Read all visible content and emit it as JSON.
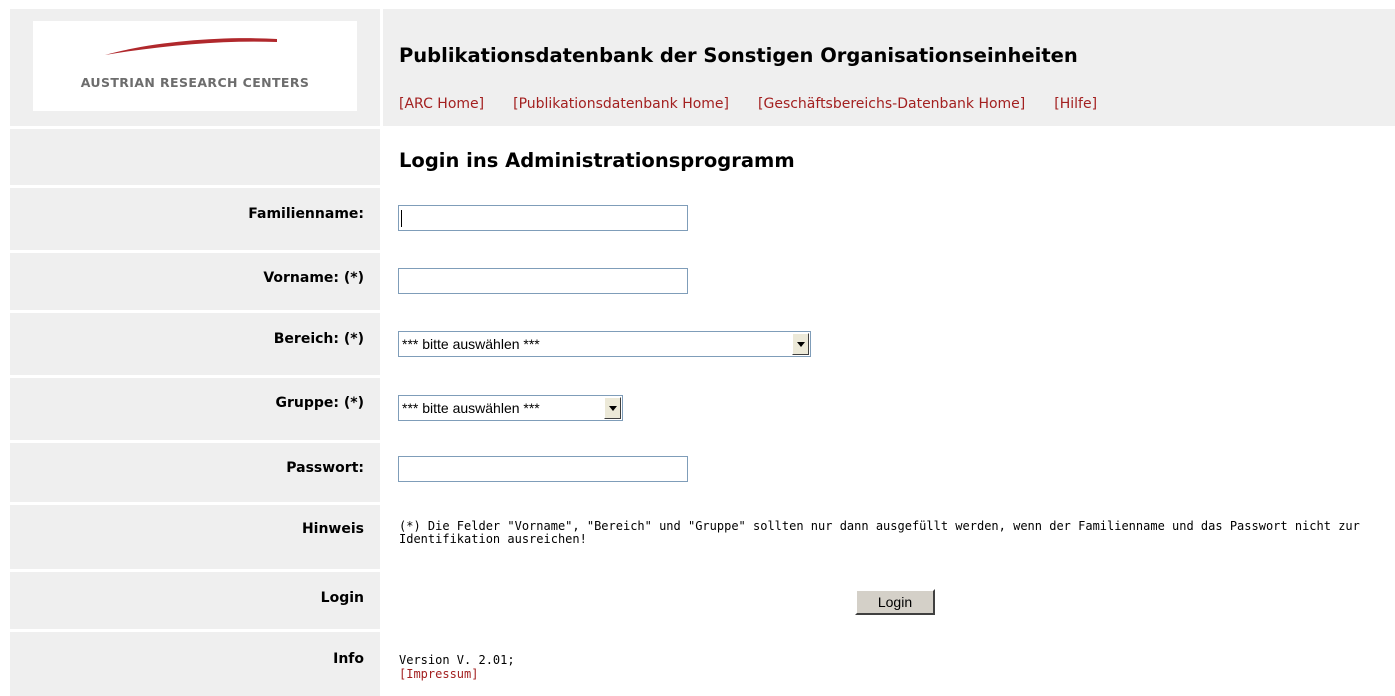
{
  "header": {
    "logo_text": "AUSTRIAN RESEARCH CENTERS",
    "title": "Publikationsdatenbank der Sonstigen Organisationseinheiten",
    "nav": [
      {
        "label": "[ARC Home]"
      },
      {
        "label": "[Publikationsdatenbank Home]"
      },
      {
        "label": "[Geschäftsbereichs-Datenbank Home]"
      },
      {
        "label": "[Hilfe]"
      }
    ]
  },
  "form": {
    "title": "Login ins Administrationsprogramm",
    "familienname": {
      "label": "Familienname:",
      "value": ""
    },
    "vorname": {
      "label": "Vorname: (*)",
      "value": ""
    },
    "bereich": {
      "label": "Bereich: (*)",
      "selected": "*** bitte auswählen ***"
    },
    "gruppe": {
      "label": "Gruppe: (*)",
      "selected": "*** bitte auswählen ***"
    },
    "passwort": {
      "label": "Passwort:",
      "value": ""
    },
    "hinweis": {
      "label": "Hinweis",
      "text": "(*) Die Felder \"Vorname\", \"Bereich\" und \"Gruppe\" sollten nur dann ausgefüllt werden, wenn der Familienname und das Passwort nicht zur Identifikation ausreichen!"
    },
    "login": {
      "label": "Login",
      "button": "Login"
    },
    "info": {
      "label": "Info",
      "version": "Version V. 2.01;",
      "impressum": "[Impressum]"
    }
  },
  "colors": {
    "panel_bg": "#efefef",
    "link": "#a32020",
    "logo_swoosh": "#b0282c",
    "logo_text": "#6d6d6d"
  }
}
